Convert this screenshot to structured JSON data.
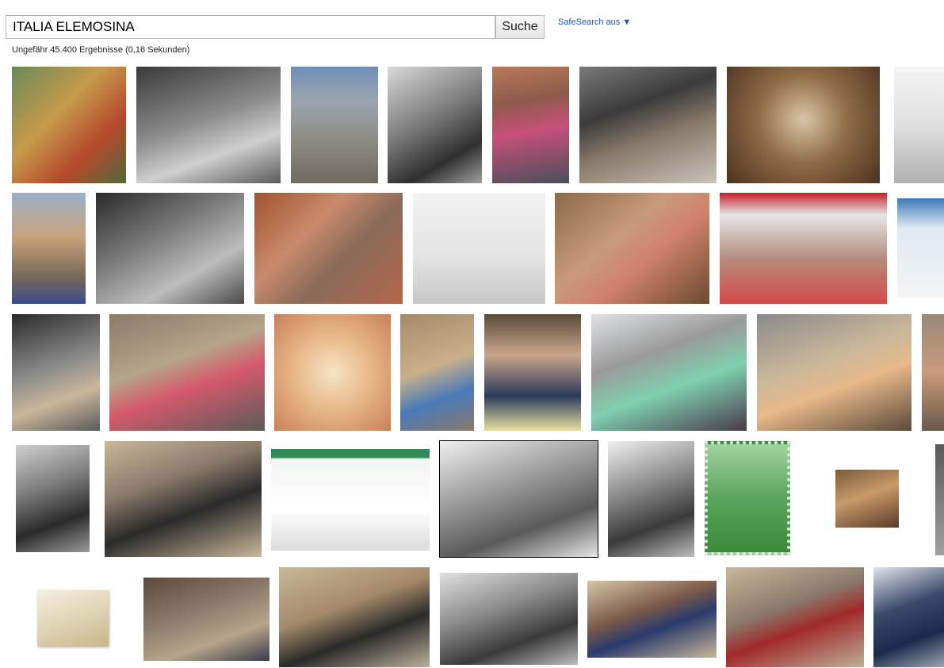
{
  "search": {
    "query": "ITALIA ELEMOSINA",
    "button_label": "Suche",
    "safesearch_label": "SafeSearch aus",
    "safesearch_arrow": "▼",
    "result_stats": "Ungefähr 45.400 Ergebnisse (0,16 Sekunden)"
  }
}
